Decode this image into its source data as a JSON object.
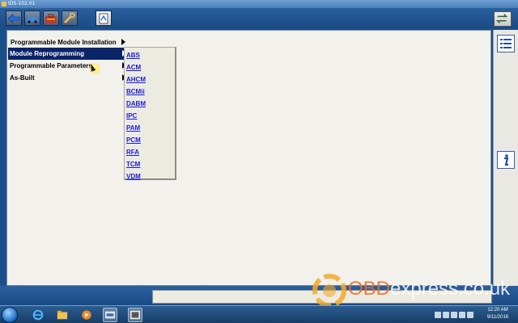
{
  "window": {
    "title": "IDS-102.01"
  },
  "menu": {
    "items": [
      {
        "label": "Programmable Module Installation"
      },
      {
        "label": "Module Reprogramming"
      },
      {
        "label": "Programmable Parameters"
      },
      {
        "label": "As-Built"
      }
    ],
    "selected_index": 1
  },
  "submenu": {
    "items": [
      "ABS",
      "ACM",
      "AHCM",
      "BCMii",
      "DABM",
      "IPC",
      "PAM",
      "PCM",
      "RFA",
      "TCM",
      "VDM"
    ]
  },
  "watermark": {
    "prefix": "OBD",
    "rest": "express.co.uk"
  },
  "clock": {
    "time": "12:20 AM",
    "date": "9/11/2016"
  },
  "colors": {
    "selected_bg": "#0a246a",
    "link": "#1a1ad6",
    "toolbar": "#1a4b85"
  }
}
